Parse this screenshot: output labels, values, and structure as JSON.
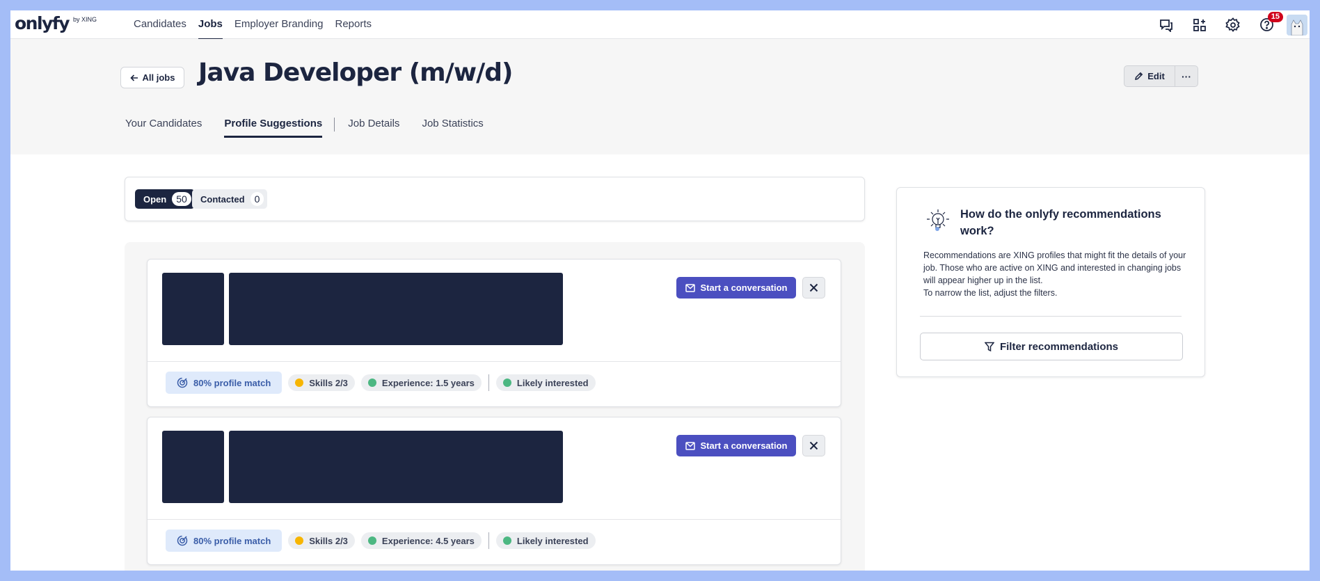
{
  "brand": {
    "name": "onlyfy",
    "byline": "by XING"
  },
  "nav": {
    "items": [
      "Candidates",
      "Jobs",
      "Employer Branding",
      "Reports"
    ],
    "active": "Jobs"
  },
  "topbar": {
    "notification_count": "15",
    "icons": [
      "chat-icon",
      "apps-add-icon",
      "gear-icon",
      "help-icon",
      "avatar"
    ]
  },
  "header": {
    "back_label": "All jobs",
    "job_title": "Java Developer (m/w/d)",
    "edit_label": "Edit",
    "more_label": "···"
  },
  "tabs": [
    "Your Candidates",
    "Profile Suggestions",
    "Job Details",
    "Job Statistics"
  ],
  "active_tab": "Profile Suggestions",
  "filters": {
    "open_label": "Open",
    "open_count": "50",
    "contacted_label": "Contacted",
    "contacted_count": "0"
  },
  "candidates": [
    {
      "action_label": "Start a conversation",
      "match": "80% profile match",
      "skills": "Skills 2/3",
      "experience": "Experience: 1.5 years",
      "interest": "Likely interested"
    },
    {
      "action_label": "Start a conversation",
      "match": "80% profile match",
      "skills": "Skills 2/3",
      "experience": "Experience: 4.5 years",
      "interest": "Likely interested"
    }
  ],
  "help": {
    "title": "How do the onlyfy recommendations work?",
    "body": "Recommendations are XING profiles that might fit the details of your job. Those who are active on XING and interested in changing jobs will appear higher up in the list.",
    "body2": "To narrow the list, adjust the filters.",
    "filter_label": "Filter recommendations"
  },
  "colors": {
    "primary": "#1c2540",
    "accent": "#4b4fc0",
    "skills_dot": "#f7b500",
    "interest_dot": "#4cb782",
    "badge": "#d0021b"
  }
}
